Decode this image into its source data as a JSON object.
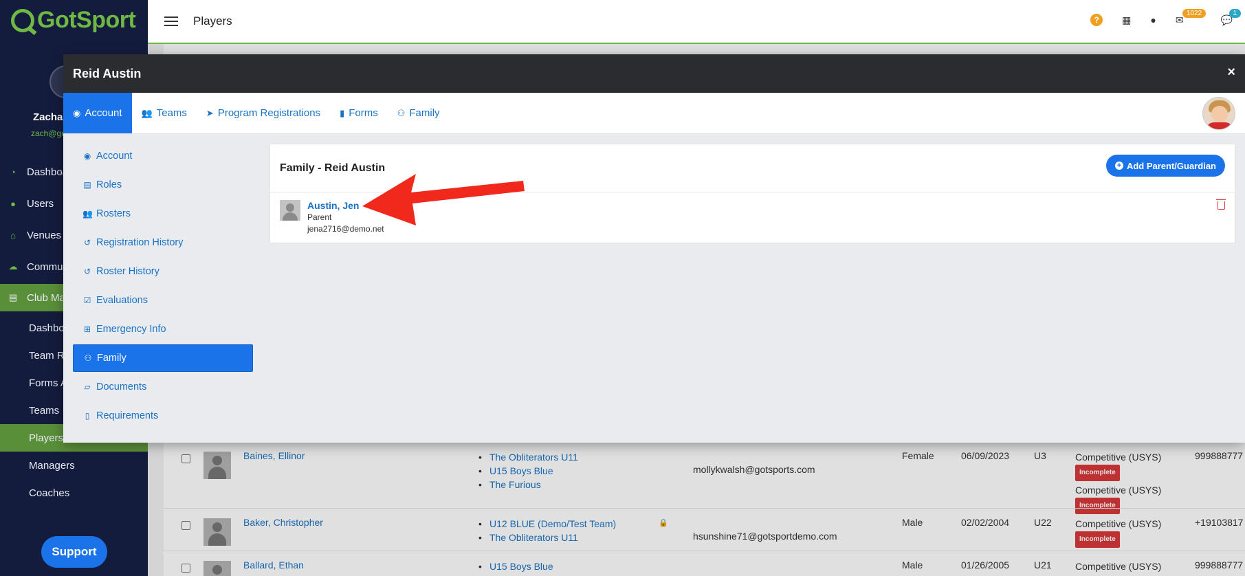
{
  "app": {
    "logo_text": "GotSport",
    "page_title": "Players",
    "user": {
      "name": "Zachar",
      "email": "zach@go"
    },
    "support_label": "Support",
    "badges": {
      "messages": "1022",
      "chat": "1"
    }
  },
  "nav": {
    "items": [
      {
        "label": "Dashboa",
        "icon": "dashboard-icon"
      },
      {
        "label": "Users",
        "icon": "users-icon"
      },
      {
        "label": "Venues",
        "icon": "venues-icon"
      },
      {
        "label": "Commun",
        "icon": "communication-icon"
      },
      {
        "label": "Club Ma",
        "icon": "club-management-icon"
      }
    ],
    "sub_items": [
      {
        "label": "Dashbo"
      },
      {
        "label": "Team R"
      },
      {
        "label": "Forms A"
      },
      {
        "label": "Teams"
      },
      {
        "label": "Players"
      },
      {
        "label": "Managers"
      },
      {
        "label": "Coaches"
      }
    ]
  },
  "players_table": {
    "rows": [
      {
        "name": "Baines, Ellinor",
        "teams": [
          "The Obliterators U11",
          "U15 Boys Blue",
          "The Furious"
        ],
        "email": "mollykwalsh@gotsports.com",
        "gender": "Female",
        "dob": "06/09/2023",
        "age": "U3",
        "levels": [
          {
            "label": "Competitive (USYS)",
            "status": "Incomplete"
          },
          {
            "label": "Competitive (USYS)",
            "status": "Incomplete"
          }
        ],
        "phone": "999888777"
      },
      {
        "name": "Baker, Christopher",
        "teams": [
          "U12 BLUE (Demo/Test Team)",
          "The Obliterators U11"
        ],
        "email": "hsunshine71@gotsportdemo.com",
        "gender": "Male",
        "dob": "02/02/2004",
        "age": "U22",
        "levels": [
          {
            "label": "Competitive (USYS)",
            "status": "Incomplete"
          }
        ],
        "phone": "+19103817"
      },
      {
        "name": "Ballard, Ethan",
        "teams": [
          "U15 Boys Blue"
        ],
        "email": "",
        "gender": "Male",
        "dob": "01/26/2005",
        "age": "U21",
        "levels": [
          {
            "label": "Competitive (USYS)",
            "status": ""
          }
        ],
        "phone": "999888777"
      }
    ]
  },
  "modal": {
    "title": "Reid Austin",
    "close_label": "×",
    "tabs": [
      {
        "label": "Account",
        "icon": "user-circle-icon",
        "glyph": "◉"
      },
      {
        "label": "Teams",
        "icon": "users-icon",
        "glyph": "👥"
      },
      {
        "label": "Program Registrations",
        "icon": "paper-plane-icon",
        "glyph": "➤"
      },
      {
        "label": "Forms",
        "icon": "file-icon",
        "glyph": "▮"
      },
      {
        "label": "Family",
        "icon": "sitemap-icon",
        "glyph": "⚇"
      }
    ],
    "side_menu": [
      {
        "label": "Account",
        "icon": "user-circle-icon",
        "glyph": "◉"
      },
      {
        "label": "Roles",
        "icon": "id-card-icon",
        "glyph": "▤"
      },
      {
        "label": "Rosters",
        "icon": "users-icon",
        "glyph": "👥"
      },
      {
        "label": "Registration History",
        "icon": "history-icon",
        "glyph": "↺"
      },
      {
        "label": "Roster History",
        "icon": "history-icon",
        "glyph": "↺"
      },
      {
        "label": "Evaluations",
        "icon": "calendar-check-icon",
        "glyph": "☑"
      },
      {
        "label": "Emergency Info",
        "icon": "plus-square-icon",
        "glyph": "⊞"
      },
      {
        "label": "Family",
        "icon": "sitemap-icon",
        "glyph": "⚇"
      },
      {
        "label": "Documents",
        "icon": "folder-open-icon",
        "glyph": "▱"
      },
      {
        "label": "Requirements",
        "icon": "file-text-icon",
        "glyph": "▯"
      }
    ],
    "family": {
      "title": "Family - Reid Austin",
      "add_button_label": "Add Parent/Guardian",
      "members": [
        {
          "name": "Austin, Jen",
          "role": "Parent",
          "email": "jena2716@demo.net"
        }
      ]
    }
  },
  "colors": {
    "primary": "#1a73e8",
    "sidebar_bg": "#141c3d",
    "brand_green": "#6fb844",
    "modal_header": "#2b2c2f",
    "annotation_arrow": "#f0291c"
  }
}
